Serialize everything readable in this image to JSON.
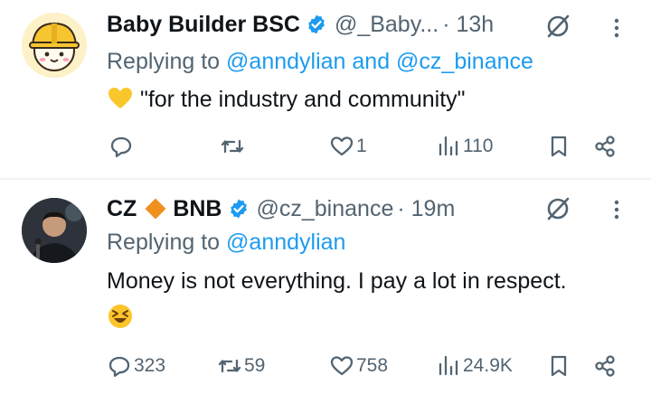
{
  "tweets": [
    {
      "author_name": "Baby Builder BSC",
      "handle": "@_Baby...",
      "time": "· 13h",
      "replying_prefix": "Replying to ",
      "replying_to": "@anndylian and @cz_binance",
      "text": "\"for the industry and community\"",
      "emoji": "yellow-heart",
      "replies": "",
      "retweets": "",
      "likes": "1",
      "views": "110"
    },
    {
      "author_name_part1": "CZ",
      "author_name_part2": "BNB",
      "handle": "@cz_binance",
      "time": "· 19m",
      "replying_prefix": "Replying to ",
      "replying_to": "@anndylian",
      "text": "Money is not everything. I pay a lot in respect.",
      "emoji": "laughing-face",
      "replies": "323",
      "retweets": "59",
      "likes": "758",
      "views": "24.9K"
    }
  ],
  "colors": {
    "link": "#1d9bf0",
    "secondary_text": "#536471",
    "verified": "#1d9bf0",
    "diamond": "#f0901e"
  }
}
